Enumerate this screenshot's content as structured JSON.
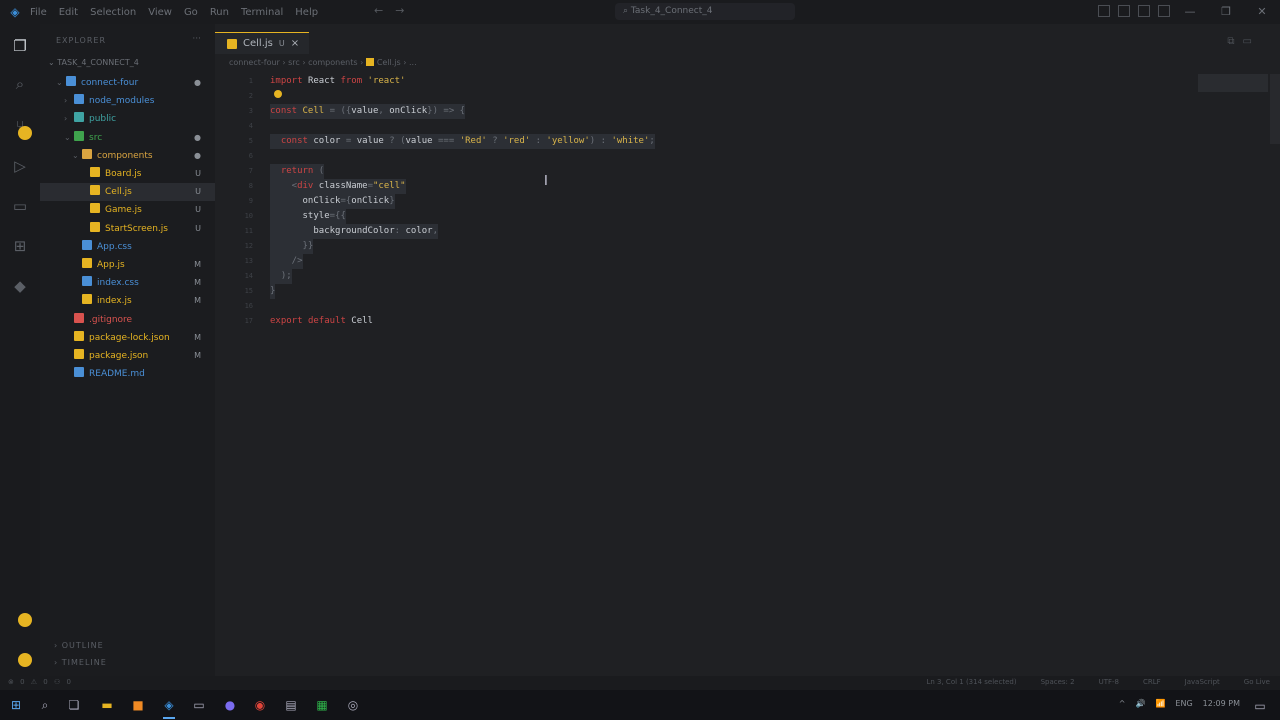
{
  "titlebar": {
    "app_icon": "vscode-logo",
    "menu": [
      "File",
      "Edit",
      "Selection",
      "View",
      "Go",
      "Run",
      "Terminal",
      "Help"
    ],
    "search_text": "Task_4_Connect_4",
    "controls": [
      "—",
      "❐",
      "✕"
    ]
  },
  "sidebar": {
    "header": "EXPLORER",
    "project": "TASK_4_CONNECT_4",
    "tree": [
      {
        "label": "connect-four",
        "icon_color": "#4a8fd6",
        "indent": 1,
        "twisty": "⌄",
        "badge": "●"
      },
      {
        "label": "node_modules",
        "icon_color": "#4a8fd6",
        "indent": 2,
        "twisty": "›",
        "badge": ""
      },
      {
        "label": "public",
        "icon_color": "#3fa3a3",
        "indent": 2,
        "twisty": "›",
        "badge": ""
      },
      {
        "label": "src",
        "icon_color": "#3fa34d",
        "indent": 2,
        "twisty": "⌄",
        "badge": "●"
      },
      {
        "label": "components",
        "icon_color": "#d9a441",
        "indent": 3,
        "twisty": "⌄",
        "badge": "●"
      },
      {
        "label": "Board.js",
        "icon_color": "#e6b422",
        "indent": 4,
        "twisty": "",
        "badge": "U"
      },
      {
        "label": "Cell.js",
        "icon_color": "#e6b422",
        "indent": 4,
        "twisty": "",
        "badge": "U",
        "active": true
      },
      {
        "label": "Game.js",
        "icon_color": "#e6b422",
        "indent": 4,
        "twisty": "",
        "badge": "U"
      },
      {
        "label": "StartScreen.js",
        "icon_color": "#e6b422",
        "indent": 4,
        "twisty": "",
        "badge": "U"
      },
      {
        "label": "App.css",
        "icon_color": "#4a8fd6",
        "indent": 3,
        "twisty": "",
        "badge": ""
      },
      {
        "label": "App.js",
        "icon_color": "#e6b422",
        "indent": 3,
        "twisty": "",
        "badge": "M"
      },
      {
        "label": "index.css",
        "icon_color": "#4a8fd6",
        "indent": 3,
        "twisty": "",
        "badge": "M"
      },
      {
        "label": "index.js",
        "icon_color": "#e6b422",
        "indent": 3,
        "twisty": "",
        "badge": "M"
      },
      {
        "label": ".gitignore",
        "icon_color": "#d9534f",
        "indent": 2,
        "twisty": "",
        "badge": ""
      },
      {
        "label": "package-lock.json",
        "icon_color": "#e6b422",
        "indent": 2,
        "twisty": "",
        "badge": "M"
      },
      {
        "label": "package.json",
        "icon_color": "#e6b422",
        "indent": 2,
        "twisty": "",
        "badge": "M"
      },
      {
        "label": "README.md",
        "icon_color": "#4a8fd6",
        "indent": 2,
        "twisty": "",
        "badge": ""
      }
    ],
    "outline": "OUTLINE",
    "timeline": "TIMELINE"
  },
  "editor": {
    "tab": {
      "label": "Cell.js",
      "badge": "U",
      "close": "×"
    },
    "breadcrumbs": "connect-four › src › components ›",
    "breadcrumb_file": "Cell.js › ...",
    "code": [
      {
        "n": "1",
        "sel": false,
        "parts": [
          [
            "k",
            "import "
          ],
          [
            "id",
            "React "
          ],
          [
            "k",
            "from "
          ],
          [
            "str",
            "'react'"
          ]
        ]
      },
      {
        "n": "2",
        "sel": false,
        "parts": []
      },
      {
        "n": "3",
        "sel": true,
        "parts": [
          [
            "k",
            "const "
          ],
          [
            "fn",
            "Cell "
          ],
          [
            "pl",
            "= "
          ],
          [
            "pl",
            "({"
          ],
          [
            "id",
            "value"
          ],
          [
            "pl",
            ", "
          ],
          [
            "id",
            "onClick"
          ],
          [
            "pl",
            "}) => {"
          ]
        ]
      },
      {
        "n": "4",
        "sel": true,
        "parts": []
      },
      {
        "n": "5",
        "sel": true,
        "parts": [
          [
            "pl",
            "  "
          ],
          [
            "k",
            "const "
          ],
          [
            "id",
            "color "
          ],
          [
            "pl",
            "= "
          ],
          [
            "id",
            "value "
          ],
          [
            "pl",
            "? ("
          ],
          [
            "id",
            "value "
          ],
          [
            "pl",
            "=== "
          ],
          [
            "str",
            "'Red' "
          ],
          [
            "pl",
            "? "
          ],
          [
            "str",
            "'red' "
          ],
          [
            "pl",
            ": "
          ],
          [
            "str",
            "'yellow'"
          ],
          [
            "pl",
            ") : "
          ],
          [
            "str",
            "'white'"
          ],
          [
            "pl",
            ";"
          ]
        ]
      },
      {
        "n": "6",
        "sel": true,
        "parts": []
      },
      {
        "n": "7",
        "sel": true,
        "parts": [
          [
            "pl",
            "  "
          ],
          [
            "k",
            "return "
          ],
          [
            "pl",
            "("
          ]
        ]
      },
      {
        "n": "8",
        "sel": true,
        "parts": [
          [
            "pl",
            "    <"
          ],
          [
            "k",
            "div "
          ],
          [
            "id",
            "className"
          ],
          [
            "pl",
            "="
          ],
          [
            "str",
            "\"cell\""
          ]
        ]
      },
      {
        "n": "9",
        "sel": true,
        "parts": [
          [
            "pl",
            "      "
          ],
          [
            "id",
            "onClick"
          ],
          [
            "pl",
            "={"
          ],
          [
            "id",
            "onClick"
          ],
          [
            "pl",
            "}"
          ]
        ]
      },
      {
        "n": "10",
        "sel": true,
        "parts": [
          [
            "pl",
            "      "
          ],
          [
            "id",
            "style"
          ],
          [
            "pl",
            "={{"
          ]
        ]
      },
      {
        "n": "11",
        "sel": true,
        "parts": [
          [
            "pl",
            "        "
          ],
          [
            "id",
            "backgroundColor"
          ],
          [
            "pl",
            ": "
          ],
          [
            "id",
            "color"
          ],
          [
            "pl",
            ","
          ]
        ]
      },
      {
        "n": "12",
        "sel": true,
        "parts": [
          [
            "pl",
            "      }}"
          ]
        ]
      },
      {
        "n": "13",
        "sel": true,
        "parts": [
          [
            "pl",
            "    />"
          ]
        ]
      },
      {
        "n": "14",
        "sel": true,
        "parts": [
          [
            "pl",
            "  );"
          ]
        ]
      },
      {
        "n": "15",
        "sel": true,
        "parts": [
          [
            "pl",
            "}"
          ]
        ]
      },
      {
        "n": "16",
        "sel": false,
        "parts": []
      },
      {
        "n": "17",
        "sel": false,
        "parts": [
          [
            "k",
            "export "
          ],
          [
            "k",
            "default "
          ],
          [
            "id",
            "Cell"
          ]
        ]
      }
    ]
  },
  "statusbar": {
    "left": "⊗ 0  ⚠ 0    ⚇ 0",
    "items": [
      "Ln 3, Col 1 (314 selected)",
      "Spaces: 2",
      "UTF-8",
      "CRLF",
      "JavaScript",
      "Go Live"
    ]
  },
  "taskbar": {
    "apps": [
      "windows-start-icon",
      "search-icon",
      "task-view-icon",
      "file-explorer-icon",
      "sublime-icon",
      "vscode-icon",
      "terminal-icon",
      "discord-icon",
      "chrome-icon",
      "notes-icon",
      "spreadsheet-icon",
      "obs-icon"
    ],
    "tray": [
      "^",
      "🔊",
      "📶",
      "ENG",
      "12:09 PM"
    ]
  }
}
